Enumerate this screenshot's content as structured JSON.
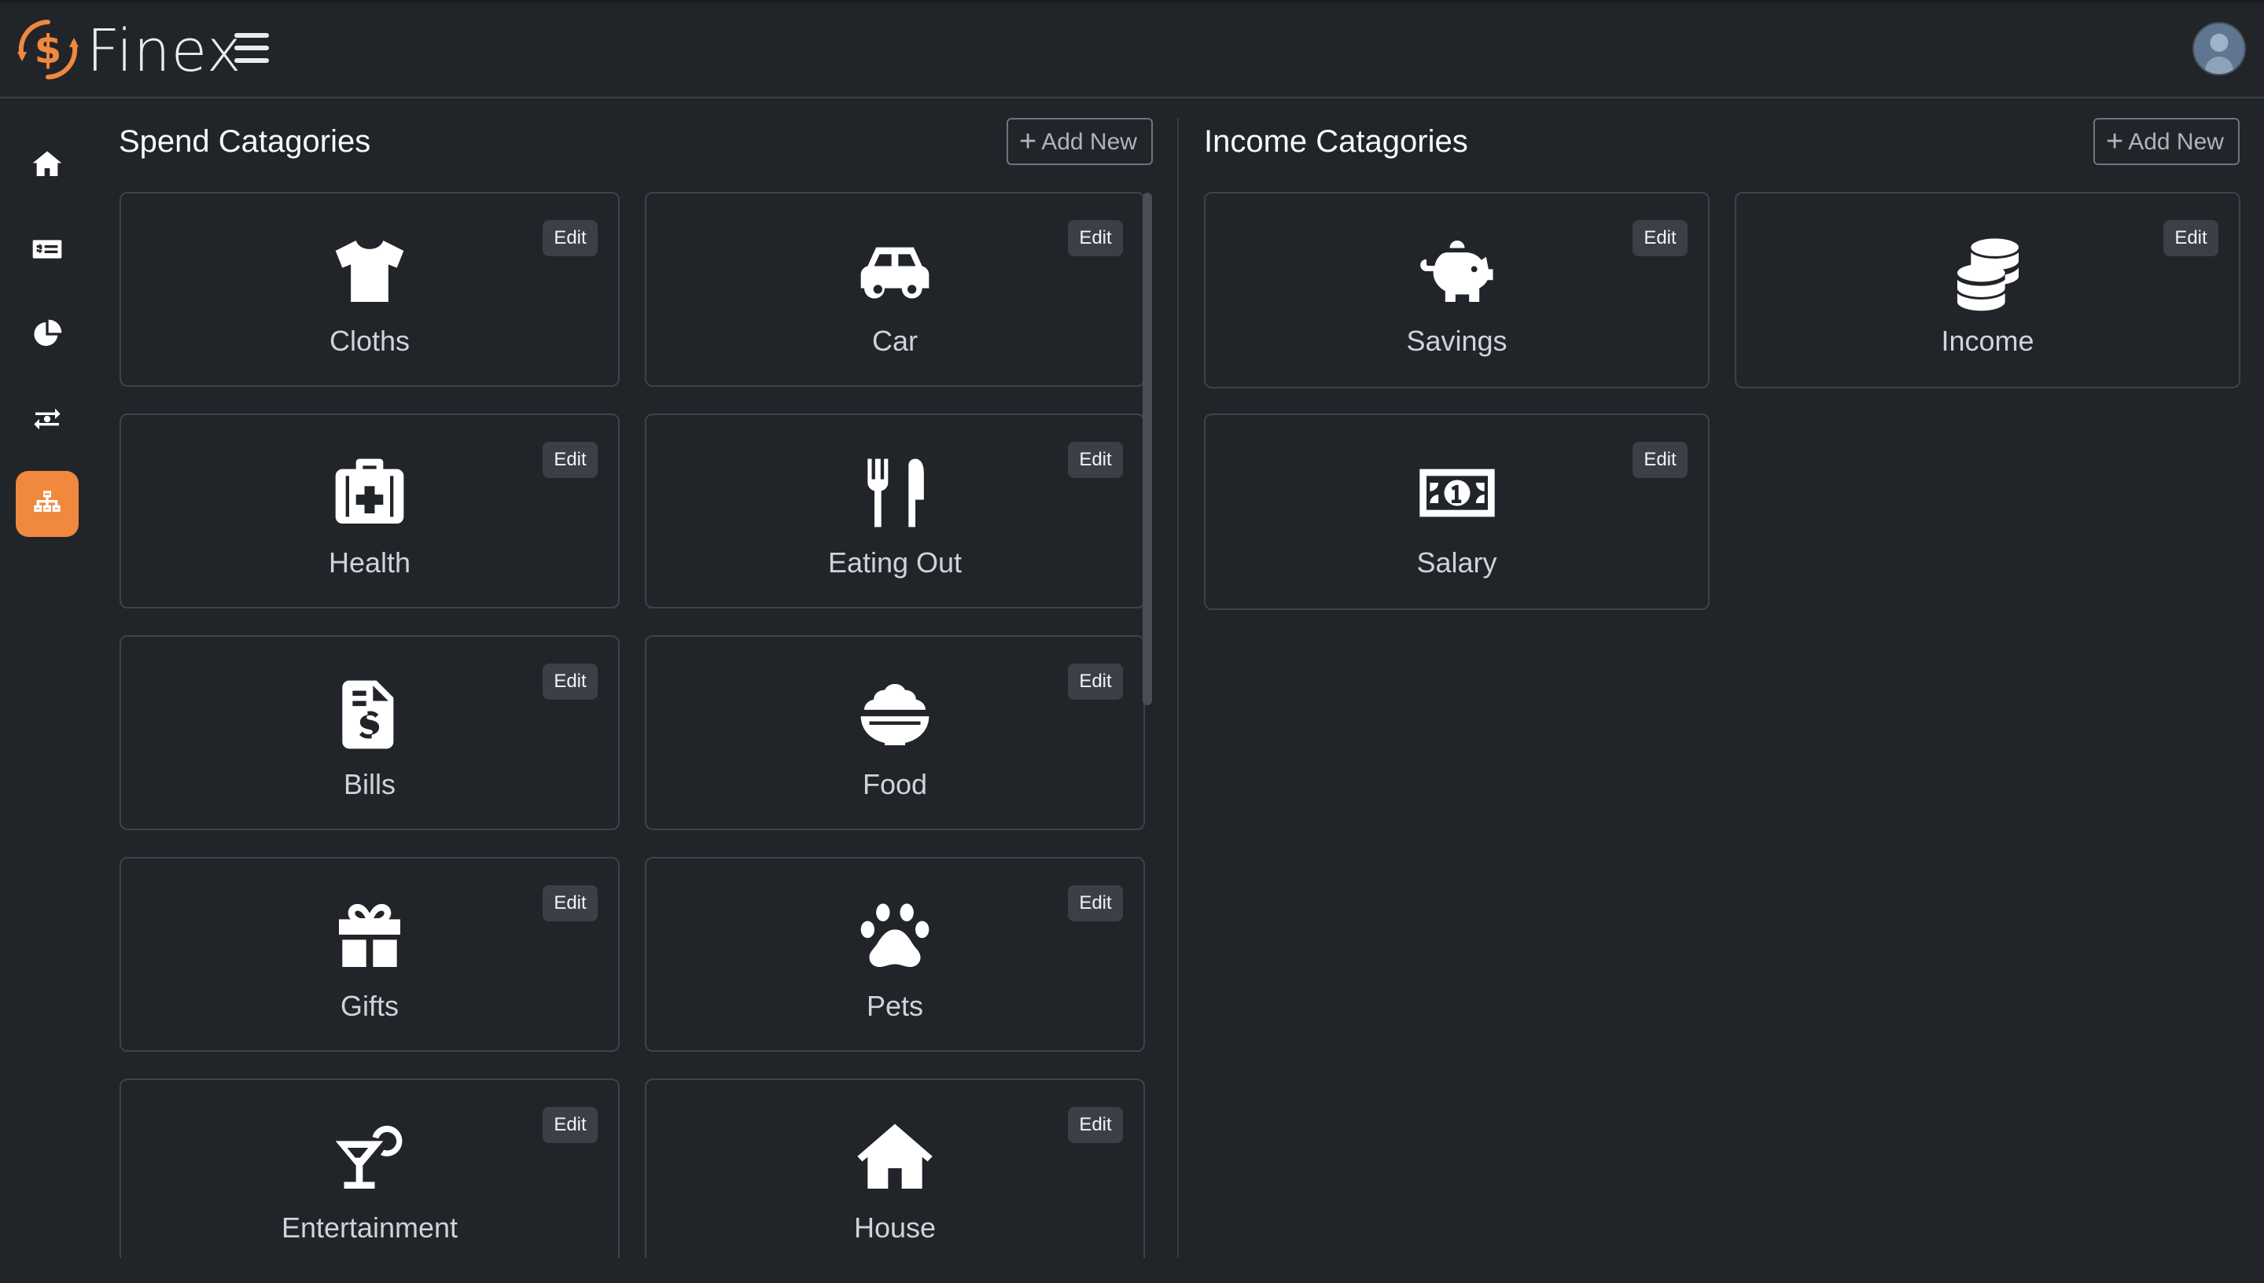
{
  "header": {
    "brand": "Finex"
  },
  "sidebar": {
    "items": [
      {
        "name": "home",
        "icon": "home-icon",
        "active": false
      },
      {
        "name": "transactions",
        "icon": "money-check-icon",
        "active": false
      },
      {
        "name": "reports",
        "icon": "pie-chart-icon",
        "active": false
      },
      {
        "name": "exchange",
        "icon": "money-transfer-icon",
        "active": false
      },
      {
        "name": "categories",
        "icon": "sitemap-icon",
        "active": true
      }
    ]
  },
  "spend": {
    "title": "Spend Catagories",
    "add_label": "Add New",
    "items": [
      {
        "label": "Cloths",
        "icon": "shirt-icon"
      },
      {
        "label": "Car",
        "icon": "car-icon"
      },
      {
        "label": "Health",
        "icon": "medical-kit-icon"
      },
      {
        "label": "Eating Out",
        "icon": "utensils-icon"
      },
      {
        "label": "Bills",
        "icon": "invoice-dollar-icon"
      },
      {
        "label": "Food",
        "icon": "bowl-food-icon"
      },
      {
        "label": "Gifts",
        "icon": "gift-icon"
      },
      {
        "label": "Pets",
        "icon": "paw-icon"
      },
      {
        "label": "Entertainment",
        "icon": "martini-icon"
      },
      {
        "label": "House",
        "icon": "house-icon"
      }
    ]
  },
  "income": {
    "title": "Income Catagories",
    "add_label": "Add New",
    "items": [
      {
        "label": "Savings",
        "icon": "piggy-bank-icon"
      },
      {
        "label": "Income",
        "icon": "coins-icon"
      },
      {
        "label": "Salary",
        "icon": "money-bill-icon"
      }
    ]
  },
  "common": {
    "edit_label": "Edit"
  },
  "colors": {
    "accent": "#f0883e",
    "background": "#212529"
  }
}
